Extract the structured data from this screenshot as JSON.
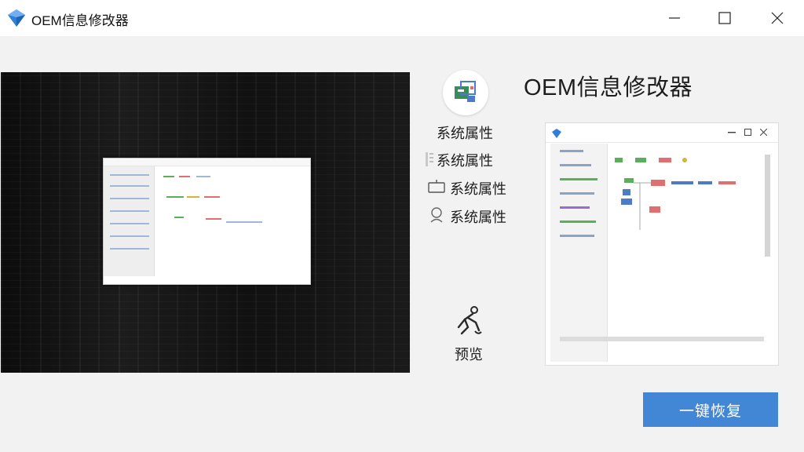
{
  "window": {
    "title": "OEM信息修改器",
    "controls": [
      "minimize",
      "maximize",
      "close"
    ]
  },
  "main": {
    "heading": "OEM信息修改器",
    "menu_items": [
      {
        "label": "系统属性",
        "icon": "system-properties-icon"
      },
      {
        "label": "系统属性",
        "icon": "panel-icon"
      },
      {
        "label": "系统属性",
        "icon": "monitor-icon"
      },
      {
        "label": "系统属性",
        "icon": "user-icon"
      }
    ],
    "preview": {
      "label": "预览",
      "icon": "preview-figure-icon"
    },
    "reset_button": "一键恢复"
  },
  "colors": {
    "accent": "#4286d6",
    "titlebar": "#ffffff",
    "background": "#f2f2f2"
  }
}
